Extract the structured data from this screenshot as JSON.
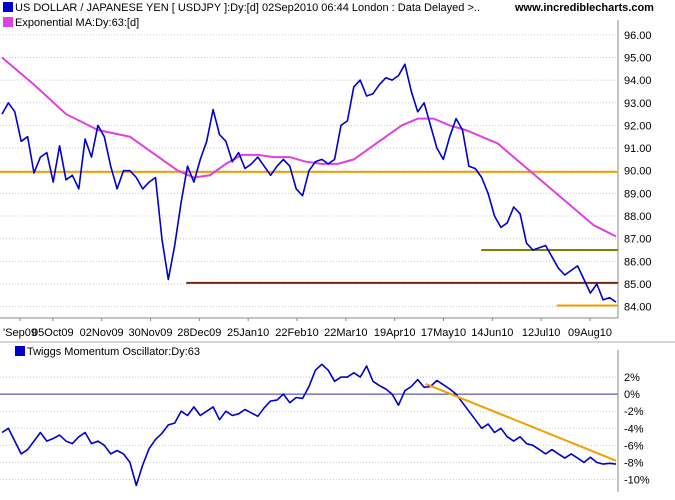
{
  "header": {
    "instrument": "US DOLLAR / JAPANESE YEN [ USDJPY ]:Dy:[d]  02Sep2010 06:44 London : Data Delayed >..",
    "website": "www.incrediblecharts.com",
    "ma_label": "Exponential MA:Dy:63:[d]",
    "osc_label": "Twiggs Momentum Oscillator:Dy:63"
  },
  "colors": {
    "price": "#0000cc",
    "ma": "#e040e0",
    "orange": "#f0a000",
    "brown": "#6b2a10",
    "olive": "#808000",
    "grid": "#c8c8c8"
  },
  "chart_data": [
    {
      "type": "line",
      "title": "US DOLLAR / JAPANESE YEN [ USDJPY ]:Dy:[d]",
      "x_tick_labels": [
        "'Sep09",
        "05Oct09",
        "02Nov09",
        "30Nov09",
        "28Dec09",
        "25Jan10",
        "22Feb10",
        "22Mar10",
        "19Apr10",
        "17May10",
        "14Jun10",
        "12Jul10",
        "09Aug10"
      ],
      "y_tick_labels": [
        "84.00",
        "85.00",
        "86.00",
        "87.00",
        "88.00",
        "89.00",
        "90.00",
        "91.00",
        "92.00",
        "93.00",
        "94.00",
        "95.00",
        "96.00"
      ],
      "ylim": [
        83.5,
        96.3
      ],
      "xlim": [
        0,
        262
      ],
      "series": [
        {
          "name": "USDJPY",
          "values": [
            [
              0,
              92.5
            ],
            [
              4,
              93
            ],
            [
              8,
              92.6
            ],
            [
              12,
              91.3
            ],
            [
              16,
              91.5
            ],
            [
              20,
              89.9
            ],
            [
              24,
              90.6
            ],
            [
              28,
              90.8
            ],
            [
              32,
              89.5
            ],
            [
              36,
              91.1
            ],
            [
              40,
              89.6
            ],
            [
              44,
              89.8
            ],
            [
              48,
              89.2
            ],
            [
              52,
              91.4
            ],
            [
              56,
              90.6
            ],
            [
              60,
              92.0
            ],
            [
              64,
              91.5
            ],
            [
              68,
              90.2
            ],
            [
              72,
              89.2
            ],
            [
              76,
              90.0
            ],
            [
              80,
              90.0
            ],
            [
              84,
              89.7
            ],
            [
              88,
              89.2
            ],
            [
              92,
              89.5
            ],
            [
              96,
              89.7
            ],
            [
              100,
              87.0
            ],
            [
              104,
              85.2
            ],
            [
              108,
              86.7
            ],
            [
              112,
              88.6
            ],
            [
              116,
              90.2
            ],
            [
              120,
              89.5
            ],
            [
              124,
              90.5
            ],
            [
              128,
              91.3
            ],
            [
              132,
              92.7
            ],
            [
              136,
              91.6
            ],
            [
              140,
              91.3
            ],
            [
              144,
              90.4
            ],
            [
              148,
              90.8
            ],
            [
              152,
              90.1
            ],
            [
              156,
              90.3
            ],
            [
              160,
              90.6
            ],
            [
              164,
              90.2
            ],
            [
              168,
              89.8
            ],
            [
              172,
              90.2
            ],
            [
              176,
              90.5
            ],
            [
              180,
              90.2
            ],
            [
              184,
              89.2
            ],
            [
              188,
              88.9
            ],
            [
              192,
              90.0
            ],
            [
              196,
              90.4
            ],
            [
              200,
              90.5
            ],
            [
              204,
              90.3
            ],
            [
              208,
              90.5
            ],
            [
              212,
              92.0
            ],
            [
              216,
              92.2
            ],
            [
              220,
              93.7
            ],
            [
              224,
              94.0
            ],
            [
              228,
              93.3
            ],
            [
              232,
              93.4
            ],
            [
              236,
              93.8
            ],
            [
              240,
              94.1
            ],
            [
              244,
              94.0
            ],
            [
              248,
              94.2
            ],
            [
              252,
              94.7
            ],
            [
              256,
              93.5
            ],
            [
              260,
              92.6
            ],
            [
              264,
              93.0
            ],
            [
              268,
              92.0
            ],
            [
              272,
              91.0
            ],
            [
              276,
              90.5
            ],
            [
              280,
              91.5
            ],
            [
              284,
              92.3
            ],
            [
              288,
              91.8
            ],
            [
              292,
              90.2
            ],
            [
              296,
              90.1
            ],
            [
              300,
              89.7
            ],
            [
              304,
              89.0
            ],
            [
              308,
              88.0
            ],
            [
              312,
              87.5
            ],
            [
              316,
              87.7
            ],
            [
              320,
              88.4
            ],
            [
              324,
              88.1
            ],
            [
              328,
              86.8
            ],
            [
              332,
              86.5
            ],
            [
              336,
              86.6
            ],
            [
              340,
              86.7
            ],
            [
              344,
              86.2
            ],
            [
              348,
              85.7
            ],
            [
              352,
              85.4
            ],
            [
              356,
              85.6
            ],
            [
              360,
              85.8
            ],
            [
              364,
              85.2
            ],
            [
              368,
              84.6
            ],
            [
              372,
              85.0
            ],
            [
              376,
              84.3
            ],
            [
              380,
              84.4
            ],
            [
              384,
              84.2
            ]
          ]
        },
        {
          "name": "Exponential MA:Dy:63",
          "values": [
            [
              0,
              95.0
            ],
            [
              20,
              93.8
            ],
            [
              40,
              92.5
            ],
            [
              60,
              91.8
            ],
            [
              80,
              91.5
            ],
            [
              100,
              90.5
            ],
            [
              110,
              90.0
            ],
            [
              120,
              89.7
            ],
            [
              130,
              89.8
            ],
            [
              140,
              90.3
            ],
            [
              150,
              90.7
            ],
            [
              160,
              90.7
            ],
            [
              170,
              90.6
            ],
            [
              180,
              90.6
            ],
            [
              190,
              90.4
            ],
            [
              200,
              90.3
            ],
            [
              210,
              90.3
            ],
            [
              220,
              90.5
            ],
            [
              230,
              91.0
            ],
            [
              240,
              91.5
            ],
            [
              250,
              92.0
            ],
            [
              260,
              92.3
            ],
            [
              270,
              92.3
            ],
            [
              280,
              92.0
            ],
            [
              290,
              91.8
            ],
            [
              300,
              91.5
            ],
            [
              310,
              91.2
            ],
            [
              320,
              90.6
            ],
            [
              330,
              90.0
            ],
            [
              340,
              89.4
            ],
            [
              350,
              88.8
            ],
            [
              360,
              88.2
            ],
            [
              370,
              87.6
            ],
            [
              384,
              87.1
            ]
          ]
        }
      ],
      "lines": [
        {
          "color": "orange",
          "y": 89.95,
          "x": [
            0,
            262
          ]
        },
        {
          "color": "brown",
          "y": 85.05,
          "x": [
            79,
            262
          ]
        },
        {
          "color": "olive",
          "y": 86.5,
          "x": [
            204,
            262
          ]
        },
        {
          "color": "orange",
          "y": 84.05,
          "x": [
            236,
            262
          ]
        }
      ]
    },
    {
      "type": "line",
      "title": "Twiggs Momentum Oscillator:Dy:63",
      "y_tick_labels": [
        "2%",
        "0%",
        "-2%",
        "-4%",
        "-6%",
        "-8%",
        "-10%"
      ],
      "ylim": [
        -11,
        4
      ],
      "series": [
        {
          "name": "Twiggs Momentum Oscillator:Dy:63",
          "values": [
            [
              0,
              -4.5
            ],
            [
              4,
              -4.0
            ],
            [
              8,
              -5.5
            ],
            [
              12,
              -7.0
            ],
            [
              16,
              -6.5
            ],
            [
              20,
              -5.5
            ],
            [
              24,
              -4.5
            ],
            [
              28,
              -5.5
            ],
            [
              32,
              -5.2
            ],
            [
              36,
              -4.8
            ],
            [
              40,
              -5.5
            ],
            [
              44,
              -5.8
            ],
            [
              48,
              -5.0
            ],
            [
              52,
              -4.5
            ],
            [
              56,
              -5.8
            ],
            [
              60,
              -5.5
            ],
            [
              64,
              -6.0
            ],
            [
              68,
              -7.0
            ],
            [
              72,
              -6.6
            ],
            [
              76,
              -7.0
            ],
            [
              80,
              -8.0
            ],
            [
              84,
              -10.7
            ],
            [
              88,
              -8.3
            ],
            [
              92,
              -6.4
            ],
            [
              96,
              -5.3
            ],
            [
              100,
              -4.6
            ],
            [
              104,
              -3.6
            ],
            [
              108,
              -3.4
            ],
            [
              112,
              -2.0
            ],
            [
              116,
              -2.5
            ],
            [
              120,
              -1.5
            ],
            [
              124,
              -2.5
            ],
            [
              128,
              -2.0
            ],
            [
              132,
              -1.5
            ],
            [
              136,
              -3.0
            ],
            [
              140,
              -2.0
            ],
            [
              144,
              -2.5
            ],
            [
              148,
              -2.3
            ],
            [
              152,
              -1.8
            ],
            [
              156,
              -2.2
            ],
            [
              160,
              -2.6
            ],
            [
              164,
              -1.6
            ],
            [
              168,
              -0.8
            ],
            [
              172,
              -0.7
            ],
            [
              176,
              0.0
            ],
            [
              180,
              -1.0
            ],
            [
              184,
              -0.4
            ],
            [
              188,
              -0.5
            ],
            [
              192,
              0.9
            ],
            [
              196,
              2.8
            ],
            [
              200,
              3.5
            ],
            [
              204,
              2.8
            ],
            [
              208,
              1.5
            ],
            [
              212,
              2.0
            ],
            [
              216,
              2.0
            ],
            [
              220,
              2.5
            ],
            [
              224,
              2.0
            ],
            [
              228,
              3.3
            ],
            [
              232,
              1.5
            ],
            [
              236,
              1.0
            ],
            [
              240,
              0.6
            ],
            [
              244,
              0.0
            ],
            [
              248,
              -1.3
            ],
            [
              252,
              0.4
            ],
            [
              256,
              0.9
            ],
            [
              260,
              1.7
            ],
            [
              264,
              0.8
            ],
            [
              268,
              0.9
            ],
            [
              272,
              1.6
            ],
            [
              276,
              1.1
            ],
            [
              280,
              0.6
            ],
            [
              284,
              0.0
            ],
            [
              288,
              -1.0
            ],
            [
              292,
              -2.0
            ],
            [
              296,
              -3.0
            ],
            [
              300,
              -4.0
            ],
            [
              304,
              -3.5
            ],
            [
              308,
              -4.5
            ],
            [
              312,
              -4.0
            ],
            [
              316,
              -5.0
            ],
            [
              320,
              -5.5
            ],
            [
              324,
              -5.0
            ],
            [
              328,
              -5.8
            ],
            [
              332,
              -6.0
            ],
            [
              336,
              -6.5
            ],
            [
              340,
              -7.0
            ],
            [
              344,
              -6.5
            ],
            [
              348,
              -7.0
            ],
            [
              352,
              -7.5
            ],
            [
              356,
              -7.0
            ],
            [
              360,
              -7.5
            ],
            [
              364,
              -8.0
            ],
            [
              368,
              -7.4
            ],
            [
              372,
              -8.0
            ],
            [
              376,
              -8.2
            ],
            [
              380,
              -8.1
            ],
            [
              384,
              -8.2
            ]
          ]
        }
      ],
      "trendline": {
        "color": "orange",
        "from": [
          265,
          1.2
        ],
        "to": [
          384,
          -7.8
        ]
      }
    }
  ]
}
